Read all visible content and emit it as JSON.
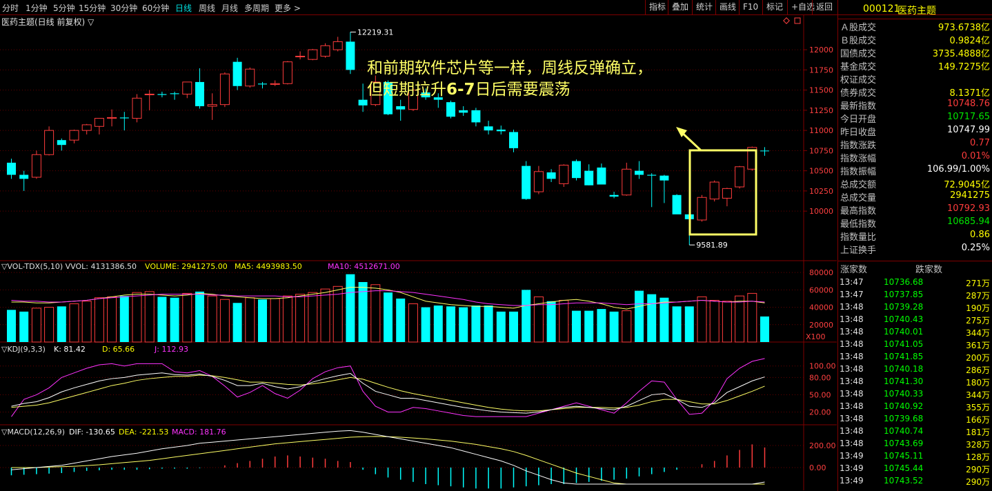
{
  "toolbar": {
    "periods": [
      "分时",
      "1分钟",
      "5分钟",
      "15分钟",
      "30分钟",
      "60分钟",
      "日线",
      "周线",
      "月线",
      "多周期",
      "更多 >"
    ],
    "active": "日线",
    "tools": [
      "指标",
      "叠加",
      "统计",
      "画线",
      "F10",
      "标记",
      "+自选",
      "返回"
    ]
  },
  "symbol": {
    "code": "000121",
    "name": "医药主题"
  },
  "main_title": "医药主题(日线 前复权) ▽",
  "annotation": {
    "line1": "和前期软件芯片等一样，周线反弹确立，",
    "line2_a": "但短期拉升",
    "line2_b": "6-7",
    "line2_c": "日后需要震荡"
  },
  "colors": {
    "up": "#ff3c3c",
    "down": "#00ffff",
    "bg": "#000000",
    "highlight": "#ffff66"
  },
  "chart_data": {
    "type": "candlestick",
    "price_axis": {
      "ticks": [
        10000,
        10250,
        10500,
        10750,
        11000,
        11250,
        11500,
        11750,
        12000
      ],
      "labels": [
        "10000",
        "10250",
        "10500",
        "10750",
        "11000",
        "11250",
        "11500",
        "11750",
        "12000"
      ]
    },
    "high_label": "12219.31",
    "low_label": "9581.89",
    "candles": [
      {
        "o": 10600,
        "h": 10650,
        "l": 10400,
        "c": 10450
      },
      {
        "o": 10450,
        "h": 10500,
        "l": 10250,
        "c": 10400
      },
      {
        "o": 10420,
        "h": 10750,
        "l": 10400,
        "c": 10700
      },
      {
        "o": 10700,
        "h": 11050,
        "l": 10690,
        "c": 11000
      },
      {
        "o": 10880,
        "h": 10900,
        "l": 10750,
        "c": 10820
      },
      {
        "o": 10880,
        "h": 11010,
        "l": 10840,
        "c": 11000
      },
      {
        "o": 11000,
        "h": 11080,
        "l": 10950,
        "c": 11070
      },
      {
        "o": 11050,
        "h": 11150,
        "l": 10950,
        "c": 11150
      },
      {
        "o": 11150,
        "h": 11260,
        "l": 11050,
        "c": 11160
      },
      {
        "o": 11160,
        "h": 11230,
        "l": 11000,
        "c": 11150
      },
      {
        "o": 11150,
        "h": 11450,
        "l": 11100,
        "c": 11400
      },
      {
        "o": 11450,
        "h": 11500,
        "l": 11250,
        "c": 11450
      },
      {
        "o": 11450,
        "h": 11480,
        "l": 11410,
        "c": 11440
      },
      {
        "o": 11460,
        "h": 11480,
        "l": 11380,
        "c": 11450
      },
      {
        "o": 11450,
        "h": 11600,
        "l": 11400,
        "c": 11600
      },
      {
        "o": 11600,
        "h": 11770,
        "l": 11270,
        "c": 11300
      },
      {
        "o": 11300,
        "h": 11460,
        "l": 11130,
        "c": 11320
      },
      {
        "o": 11320,
        "h": 11720,
        "l": 11290,
        "c": 11700
      },
      {
        "o": 11850,
        "h": 11900,
        "l": 11500,
        "c": 11550
      },
      {
        "o": 11550,
        "h": 11780,
        "l": 11530,
        "c": 11760
      },
      {
        "o": 11580,
        "h": 11600,
        "l": 11520,
        "c": 11570
      },
      {
        "o": 11570,
        "h": 11620,
        "l": 11550,
        "c": 11580
      },
      {
        "o": 11580,
        "h": 11860,
        "l": 11570,
        "c": 11850
      },
      {
        "o": 11920,
        "h": 11980,
        "l": 11880,
        "c": 11920
      },
      {
        "o": 11880,
        "h": 12010,
        "l": 11870,
        "c": 12000
      },
      {
        "o": 11920,
        "h": 12080,
        "l": 11900,
        "c": 12050
      },
      {
        "o": 12000,
        "h": 12160,
        "l": 11980,
        "c": 12100
      },
      {
        "o": 12100,
        "h": 12219,
        "l": 11700,
        "c": 11750
      },
      {
        "o": 11380,
        "h": 11580,
        "l": 11230,
        "c": 11310
      },
      {
        "o": 11320,
        "h": 11680,
        "l": 11300,
        "c": 11600
      },
      {
        "o": 11600,
        "h": 11620,
        "l": 11190,
        "c": 11200
      },
      {
        "o": 11300,
        "h": 11380,
        "l": 11120,
        "c": 11260
      },
      {
        "o": 11260,
        "h": 11540,
        "l": 11240,
        "c": 11500
      },
      {
        "o": 11470,
        "h": 11520,
        "l": 11380,
        "c": 11410
      },
      {
        "o": 11410,
        "h": 11460,
        "l": 11280,
        "c": 11380
      },
      {
        "o": 11350,
        "h": 11370,
        "l": 11150,
        "c": 11170
      },
      {
        "o": 11250,
        "h": 11300,
        "l": 11180,
        "c": 11220
      },
      {
        "o": 11250,
        "h": 11280,
        "l": 11050,
        "c": 11100
      },
      {
        "o": 11050,
        "h": 11120,
        "l": 10950,
        "c": 11000
      },
      {
        "o": 11010,
        "h": 11060,
        "l": 10950,
        "c": 10990
      },
      {
        "o": 10980,
        "h": 11010,
        "l": 10730,
        "c": 10780
      },
      {
        "o": 10560,
        "h": 10620,
        "l": 10140,
        "c": 10150
      },
      {
        "o": 10240,
        "h": 10560,
        "l": 10210,
        "c": 10490
      },
      {
        "o": 10480,
        "h": 10520,
        "l": 10360,
        "c": 10400
      },
      {
        "o": 10340,
        "h": 10580,
        "l": 10300,
        "c": 10570
      },
      {
        "o": 10620,
        "h": 10640,
        "l": 10380,
        "c": 10410
      },
      {
        "o": 10500,
        "h": 10580,
        "l": 10320,
        "c": 10320
      },
      {
        "o": 10540,
        "h": 10590,
        "l": 10340,
        "c": 10330
      },
      {
        "o": 10200,
        "h": 10240,
        "l": 10160,
        "c": 10180
      },
      {
        "o": 10200,
        "h": 10600,
        "l": 10190,
        "c": 10520
      },
      {
        "o": 10500,
        "h": 10620,
        "l": 10400,
        "c": 10450
      },
      {
        "o": 10450,
        "h": 10470,
        "l": 10050,
        "c": 10440
      },
      {
        "o": 10440,
        "h": 10450,
        "l": 10100,
        "c": 10380
      },
      {
        "o": 10200,
        "h": 10210,
        "l": 9980,
        "c": 9960
      },
      {
        "o": 9960,
        "h": 10020,
        "l": 9581,
        "c": 9900
      },
      {
        "o": 9890,
        "h": 10200,
        "l": 9870,
        "c": 10170
      },
      {
        "o": 10150,
        "h": 10380,
        "l": 10120,
        "c": 10360
      },
      {
        "o": 10160,
        "h": 10290,
        "l": 10060,
        "c": 10280
      },
      {
        "o": 10300,
        "h": 10560,
        "l": 10280,
        "c": 10550
      },
      {
        "o": 10520,
        "h": 10800,
        "l": 10500,
        "c": 10790
      },
      {
        "o": 10750,
        "h": 10793,
        "l": 10686,
        "c": 10749
      }
    ],
    "vol_title": "▽VOL-TDX(5,10) VVOL: 4131386.50",
    "vol_legend": [
      {
        "text": "VOLUME: 2941275.00",
        "color": "#ffff00"
      },
      {
        "text": "MA5: 4493983.50",
        "color": "#ffff00"
      },
      {
        "text": "MA10: 4512671.00",
        "color": "#ff33ff"
      }
    ],
    "vol_axis": {
      "ticks": [
        20000,
        40000,
        60000,
        80000
      ],
      "labels": [
        "20000",
        "40000",
        "60000",
        "80000"
      ],
      "unit": "X100"
    },
    "volumes": [
      37000,
      35000,
      39000,
      40000,
      41000,
      44000,
      47000,
      51000,
      52000,
      53000,
      57000,
      58000,
      52000,
      51000,
      56000,
      58000,
      53000,
      49000,
      45000,
      51000,
      49000,
      50000,
      53000,
      55000,
      57000,
      61000,
      64000,
      78000,
      69000,
      66000,
      57000,
      50000,
      44000,
      40000,
      42000,
      41000,
      40000,
      42000,
      42000,
      35000,
      35000,
      60000,
      52000,
      47000,
      48000,
      36000,
      36000,
      38000,
      35000,
      36000,
      59000,
      55000,
      51000,
      41000,
      41000,
      52000,
      48000,
      47000,
      53000,
      56000,
      29400
    ],
    "vol_ma5": [
      46000,
      46000,
      45000,
      45000,
      46000,
      47000,
      48000,
      50000,
      52000,
      54000,
      55000,
      55000,
      54000,
      53000,
      54000,
      56000,
      55000,
      53000,
      52000,
      51000,
      50000,
      50000,
      51000,
      53000,
      55000,
      57000,
      60000,
      63000,
      63000,
      62000,
      60000,
      57000,
      52000,
      47000,
      45000,
      43000,
      42000,
      41000,
      41000,
      40000,
      39000,
      42000,
      44000,
      46000,
      48000,
      49000,
      47000,
      44000,
      40000,
      38000,
      41000,
      44000,
      46000,
      46000,
      47000,
      48000,
      47000,
      46000,
      47000,
      47000,
      45000
    ],
    "vol_ma10": [
      48000,
      47000,
      47000,
      46000,
      46000,
      47000,
      48000,
      50000,
      51000,
      52000,
      53000,
      54000,
      55000,
      55000,
      55000,
      55000,
      54000,
      54000,
      53000,
      53000,
      53000,
      53000,
      52000,
      52000,
      53000,
      54000,
      55000,
      57000,
      58000,
      59000,
      59000,
      58000,
      57000,
      55000,
      53000,
      51000,
      49000,
      46000,
      44000,
      43000,
      42000,
      42000,
      43000,
      43000,
      44000,
      45000,
      45000,
      45000,
      44000,
      43000,
      44000,
      44000,
      45000,
      46000,
      47000,
      48000,
      47000,
      46000,
      46000,
      47000,
      46000
    ],
    "kdj_title": "▽KDJ(9,3,3)",
    "kdj_legend": [
      {
        "text": "K: 81.42",
        "color": "#ffffff"
      },
      {
        "text": "D: 65.66",
        "color": "#ffff00"
      },
      {
        "text": "J: 112.93",
        "color": "#ff33ff"
      }
    ],
    "kdj_axis": {
      "ticks": [
        20,
        50,
        80,
        100
      ],
      "labels": [
        "20.00",
        "50.00",
        "80.00",
        "100.00"
      ]
    },
    "kdj_k": [
      30,
      35,
      38,
      45,
      55,
      62,
      68,
      74,
      78,
      80,
      84,
      86,
      88,
      85,
      84,
      86,
      82,
      75,
      66,
      66,
      70,
      64,
      60,
      64,
      72,
      78,
      83,
      87,
      70,
      56,
      50,
      44,
      44,
      40,
      36,
      32,
      28,
      25,
      22,
      20,
      19,
      18,
      20,
      24,
      28,
      30,
      28,
      26,
      24,
      30,
      40,
      50,
      52,
      42,
      30,
      28,
      36,
      54,
      64,
      74,
      81
    ],
    "kdj_d": [
      28,
      30,
      32,
      36,
      42,
      48,
      54,
      60,
      66,
      70,
      75,
      78,
      80,
      82,
      82,
      84,
      83,
      80,
      76,
      72,
      72,
      70,
      68,
      67,
      69,
      72,
      76,
      80,
      77,
      70,
      63,
      57,
      52,
      48,
      44,
      40,
      36,
      32,
      28,
      25,
      23,
      22,
      22,
      24,
      26,
      28,
      28,
      28,
      27,
      28,
      32,
      38,
      42,
      42,
      38,
      34,
      34,
      40,
      48,
      56,
      65
    ],
    "kdj_j": [
      12,
      42,
      50,
      62,
      80,
      88,
      96,
      102,
      104,
      100,
      104,
      104,
      104,
      90,
      88,
      92,
      82,
      65,
      46,
      54,
      66,
      52,
      44,
      58,
      78,
      90,
      97,
      100,
      56,
      30,
      20,
      20,
      28,
      26,
      22,
      18,
      14,
      12,
      12,
      12,
      12,
      12,
      18,
      24,
      30,
      36,
      30,
      24,
      18,
      36,
      56,
      74,
      72,
      42,
      16,
      18,
      40,
      78,
      96,
      108,
      113
    ],
    "macd_title": "▽MACD(12,26,9)",
    "macd_legend": [
      {
        "text": "DIF: -130.65",
        "color": "#ffffff"
      },
      {
        "text": "DEA: -221.53",
        "color": "#ffff00"
      },
      {
        "text": "MACD: 181.76",
        "color": "#ff33ff"
      }
    ],
    "macd_axis": {
      "ticks": [
        0,
        200
      ],
      "labels": [
        "0.00",
        "200.00"
      ]
    },
    "macd_dif": [
      -20,
      -10,
      0,
      10,
      20,
      40,
      60,
      80,
      100,
      115,
      130,
      150,
      170,
      185,
      200,
      220,
      230,
      240,
      250,
      260,
      270,
      280,
      290,
      300,
      310,
      320,
      330,
      335,
      320,
      300,
      280,
      260,
      240,
      220,
      200,
      180,
      150,
      120,
      90,
      60,
      20,
      -30,
      -70,
      -110,
      -140,
      -170,
      -200,
      -230,
      -260,
      -280,
      -300,
      -320,
      -340,
      -360,
      -380,
      -380,
      -370,
      -340,
      -300,
      -240,
      -131
    ],
    "macd_dea": [
      0,
      0,
      0,
      5,
      8,
      12,
      18,
      25,
      35,
      45,
      55,
      65,
      80,
      95,
      110,
      125,
      140,
      155,
      170,
      185,
      200,
      215,
      225,
      235,
      245,
      255,
      265,
      275,
      280,
      282,
      280,
      275,
      268,
      260,
      250,
      240,
      225,
      210,
      190,
      170,
      145,
      110,
      70,
      30,
      -10,
      -50,
      -80,
      -110,
      -140,
      -170,
      -200,
      -230,
      -260,
      -290,
      -310,
      -330,
      -340,
      -340,
      -330,
      -300,
      -222
    ],
    "macd_bar": [
      -70,
      -65,
      -60,
      -55,
      -50,
      -40,
      -30,
      -25,
      -20,
      -20,
      -20,
      -15,
      -10,
      -10,
      -10,
      -5,
      0,
      20,
      40,
      60,
      80,
      100,
      110,
      100,
      90,
      80,
      60,
      50,
      -20,
      -60,
      -90,
      -110,
      -130,
      -150,
      -160,
      -170,
      -180,
      -190,
      -190,
      -190,
      -180,
      -170,
      -160,
      -150,
      -150,
      -140,
      -130,
      -120,
      -110,
      -100,
      -80,
      -60,
      -40,
      -20,
      0,
      30,
      60,
      110,
      160,
      210,
      182
    ]
  },
  "info": [
    {
      "k": "Ａ股成交",
      "v": "973.6738亿",
      "c": "ylw"
    },
    {
      "k": "Ｂ股成交",
      "v": "0.9824亿",
      "c": "ylw"
    },
    {
      "k": "国债成交",
      "v": "3735.4888亿",
      "c": "ylw"
    },
    {
      "k": "基金成交",
      "v": "149.7275亿",
      "c": "ylw"
    },
    {
      "k": "权证成交",
      "v": "",
      "c": "ylw"
    },
    {
      "k": "债券成交",
      "v": "8.1371亿",
      "c": "ylw"
    },
    {
      "k": "最新指数",
      "v": "10748.76",
      "c": "red"
    },
    {
      "k": "今日开盘",
      "v": "10717.65",
      "c": "grn"
    },
    {
      "k": "昨日收盘",
      "v": "10747.99",
      "c": "wht"
    },
    {
      "k": "指数涨跌",
      "v": "0.77",
      "c": "red"
    },
    {
      "k": "指数涨幅",
      "v": "0.01%",
      "c": "red"
    },
    {
      "k": "指数振幅",
      "v": "106.99/1.00%",
      "c": "wht"
    },
    {
      "k": "总成交额",
      "v": "72.9045亿",
      "c": "ylw"
    },
    {
      "k": "总成交量",
      "v": "2941275",
      "c": "ylw"
    },
    {
      "k": "最高指数",
      "v": "10792.93",
      "c": "red"
    },
    {
      "k": "最低指数",
      "v": "10685.94",
      "c": "grn"
    },
    {
      "k": "指数量比",
      "v": "0.86",
      "c": "ylw"
    },
    {
      "k": "上证换手",
      "v": "0.25%",
      "c": "wht"
    }
  ],
  "ticks_head": {
    "up": "涨家数",
    "down": "跌家数"
  },
  "ticks": [
    {
      "t": "13:47",
      "p": "10736.68",
      "q": "271万"
    },
    {
      "t": "13:47",
      "p": "10737.85",
      "q": "287万"
    },
    {
      "t": "13:48",
      "p": "10739.28",
      "q": "190万"
    },
    {
      "t": "13:48",
      "p": "10740.43",
      "q": "275万"
    },
    {
      "t": "13:48",
      "p": "10740.01",
      "q": "344万"
    },
    {
      "t": "13:48",
      "p": "10741.05",
      "q": "361万"
    },
    {
      "t": "13:48",
      "p": "10741.85",
      "q": "200万"
    },
    {
      "t": "13:48",
      "p": "10740.18",
      "q": "286万"
    },
    {
      "t": "13:48",
      "p": "10741.30",
      "q": "180万"
    },
    {
      "t": "13:48",
      "p": "10740.33",
      "q": "344万"
    },
    {
      "t": "13:48",
      "p": "10740.92",
      "q": "355万"
    },
    {
      "t": "13:48",
      "p": "10739.68",
      "q": "166万"
    },
    {
      "t": "13:48",
      "p": "10740.74",
      "q": "181万"
    },
    {
      "t": "13:48",
      "p": "10743.69",
      "q": "328万"
    },
    {
      "t": "13:49",
      "p": "10745.11",
      "q": "128万"
    },
    {
      "t": "13:49",
      "p": "10745.44",
      "q": "290万"
    },
    {
      "t": "13:49",
      "p": "10743.52",
      "q": "290万"
    }
  ]
}
